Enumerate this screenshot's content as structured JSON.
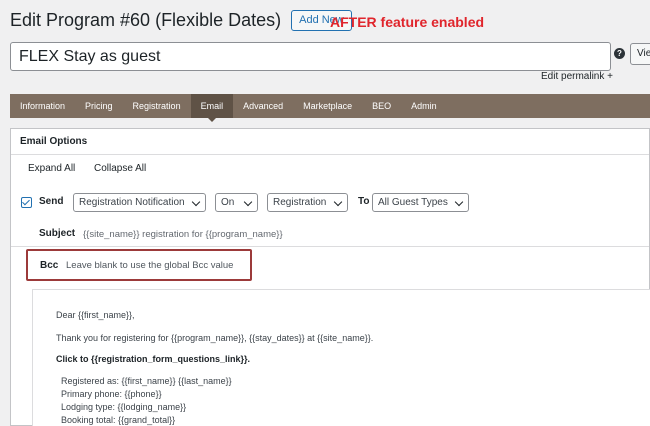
{
  "header": {
    "title": "Edit Program #60 (Flexible Dates)",
    "add_new_label": "Add New",
    "annotation": "AFTER feature enabled"
  },
  "post": {
    "title_value": "FLEX Stay as guest",
    "help_icon": "?",
    "view_label": "Vie",
    "permalink_label": "Edit permalink +"
  },
  "tabs": [
    {
      "label": "Information"
    },
    {
      "label": "Pricing"
    },
    {
      "label": "Registration"
    },
    {
      "label": "Email",
      "active": true
    },
    {
      "label": "Advanced"
    },
    {
      "label": "Marketplace"
    },
    {
      "label": "BEO"
    },
    {
      "label": "Admin"
    }
  ],
  "email": {
    "panel_title": "Email Options",
    "expand_all": "Expand All",
    "collapse_all": "Collapse All",
    "send_label": "Send",
    "send_checked": true,
    "notification_select": "Registration Notification",
    "on_select": "On",
    "trigger_select": "Registration",
    "to_label": "To",
    "guest_select": "All Guest Types",
    "subject_label": "Subject",
    "subject_value": "{{site_name}} registration for {{program_name}}",
    "bcc_label": "Bcc",
    "bcc_placeholder": "Leave blank to use the global Bcc value",
    "body": [
      "Dear {{first_name}},",
      "Thank you for registering for {{program_name}}, {{stay_dates}} at {{site_name}}.",
      "Click to {{registration_form_questions_link}}.",
      "Registered as: {{first_name}} {{last_name}}",
      "Primary phone: {{phone}}",
      "Lodging type: {{lodging_name}}",
      "Booking total: {{grand_total}}"
    ]
  },
  "colors": {
    "accent": "#2271b1",
    "annotation_red": "#e0252c",
    "tab_bar": "#7e6e60",
    "highlight_border": "#9c3a3a"
  }
}
